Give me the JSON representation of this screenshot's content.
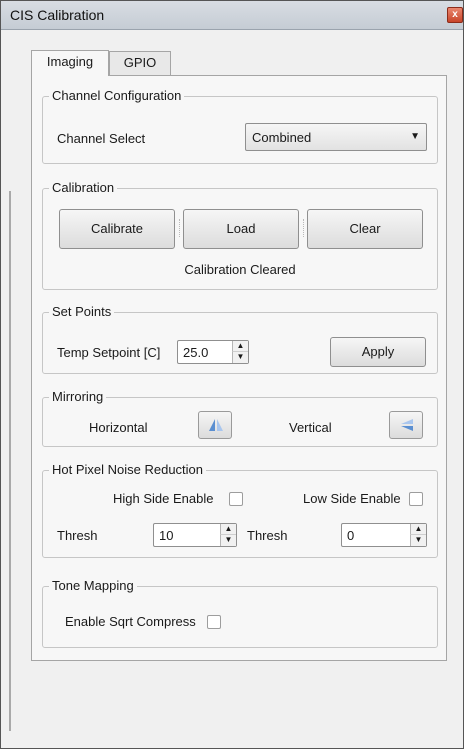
{
  "window": {
    "title": "CIS Calibration",
    "close_glyph": "x"
  },
  "tabs": [
    {
      "label": "Imaging",
      "active": true
    },
    {
      "label": "GPIO",
      "active": false
    }
  ],
  "channel_configuration": {
    "title": "Channel Configuration",
    "channel_select_label": "Channel Select",
    "channel_select_value": "Combined"
  },
  "calibration": {
    "title": "Calibration",
    "calibrate_label": "Calibrate",
    "load_label": "Load",
    "clear_label": "Clear",
    "status": "Calibration Cleared"
  },
  "set_points": {
    "title": "Set Points",
    "temp_label": "Temp Setpoint [C]",
    "temp_value": "25.0",
    "apply_label": "Apply"
  },
  "mirroring": {
    "title": "Mirroring",
    "horizontal_label": "Horizontal",
    "vertical_label": "Vertical",
    "horizontal_icon": "mirror-horizontal-icon",
    "vertical_icon": "mirror-vertical-icon"
  },
  "hot_pixel": {
    "title": "Hot Pixel Noise Reduction",
    "high_side_label": "High Side Enable",
    "high_side_checked": false,
    "low_side_label": "Low Side Enable",
    "low_side_checked": false,
    "thresh_high_label": "Thresh",
    "thresh_high_value": "10",
    "thresh_low_label": "Thresh",
    "thresh_low_value": "0"
  },
  "tone_mapping": {
    "title": "Tone Mapping",
    "sqrt_label": "Enable Sqrt Compress",
    "sqrt_checked": false
  },
  "colors": {
    "window_bg": "#f0f0f0",
    "panel_bg": "#f7f7f7",
    "icon_blue": "#5b8fd1",
    "close_red": "#c8452a"
  }
}
